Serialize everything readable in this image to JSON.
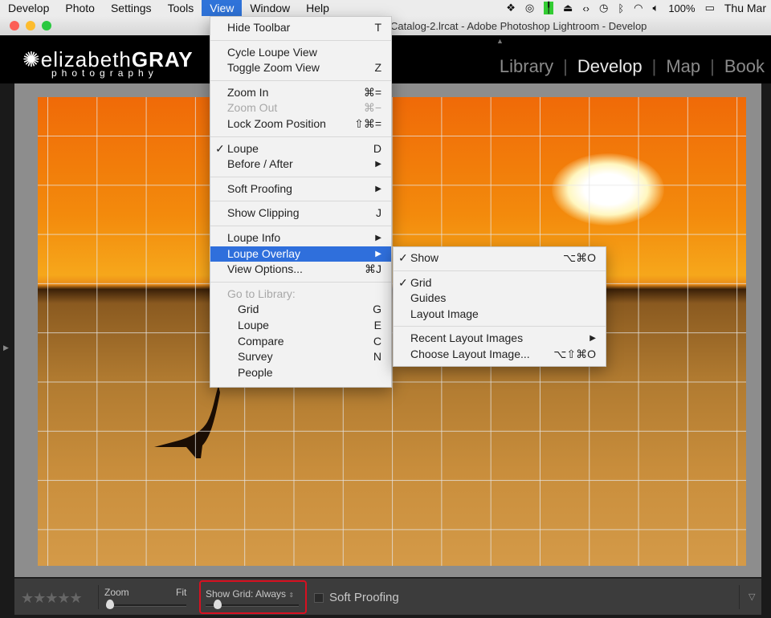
{
  "menubar": {
    "items": [
      "Develop",
      "Photo",
      "Settings",
      "Tools",
      "View",
      "Window",
      "Help"
    ],
    "active": "View",
    "status": {
      "battery": "100%",
      "clock": "Thu Mar"
    }
  },
  "window": {
    "title": "Catalog-2.lrcat - Adobe Photoshop Lightroom - Develop"
  },
  "logo": {
    "line1a": "elizabeth",
    "line1b": "GRAY",
    "line2": "photography"
  },
  "modules": [
    "Library",
    "Develop",
    "Map",
    "Book"
  ],
  "view_menu": {
    "hide_toolbar": {
      "label": "Hide Toolbar",
      "shortcut": "T"
    },
    "cycle_loupe": {
      "label": "Cycle Loupe View"
    },
    "toggle_zoom": {
      "label": "Toggle Zoom View",
      "shortcut": "Z"
    },
    "zoom_in": {
      "label": "Zoom In",
      "shortcut": "⌘="
    },
    "zoom_out": {
      "label": "Zoom Out",
      "shortcut": "⌘−"
    },
    "lock_zoom": {
      "label": "Lock Zoom Position",
      "shortcut": "⇧⌘="
    },
    "loupe": {
      "label": "Loupe",
      "shortcut": "D",
      "checked": true
    },
    "before_after": {
      "label": "Before / After"
    },
    "soft_proofing": {
      "label": "Soft Proofing"
    },
    "show_clipping": {
      "label": "Show Clipping",
      "shortcut": "J"
    },
    "loupe_info": {
      "label": "Loupe Info"
    },
    "loupe_overlay": {
      "label": "Loupe Overlay"
    },
    "view_options": {
      "label": "View Options...",
      "shortcut": "⌘J"
    },
    "go_to_library": {
      "label": "Go to Library:"
    },
    "grid": {
      "label": "Grid",
      "shortcut": "G"
    },
    "loupe2": {
      "label": "Loupe",
      "shortcut": "E"
    },
    "compare": {
      "label": "Compare",
      "shortcut": "C"
    },
    "survey": {
      "label": "Survey",
      "shortcut": "N"
    },
    "people": {
      "label": "People"
    },
    "check": "✓",
    "arrow": "▶"
  },
  "overlay_menu": {
    "show": {
      "label": "Show",
      "shortcut": "⌥⌘O",
      "checked": true
    },
    "grid": {
      "label": "Grid",
      "checked": true
    },
    "guides": {
      "label": "Guides"
    },
    "layout_image": {
      "label": "Layout Image"
    },
    "recent": {
      "label": "Recent Layout Images"
    },
    "choose": {
      "label": "Choose Layout Image...",
      "shortcut": "⌥⇧⌘O"
    }
  },
  "toolbar": {
    "stars": "★★★★★",
    "zoom_label": "Zoom",
    "zoom_value": "Fit",
    "show_grid_label": "Show Grid:",
    "show_grid_value": "Always",
    "soft_proofing": "Soft Proofing",
    "highlight_color": "#d81020"
  }
}
